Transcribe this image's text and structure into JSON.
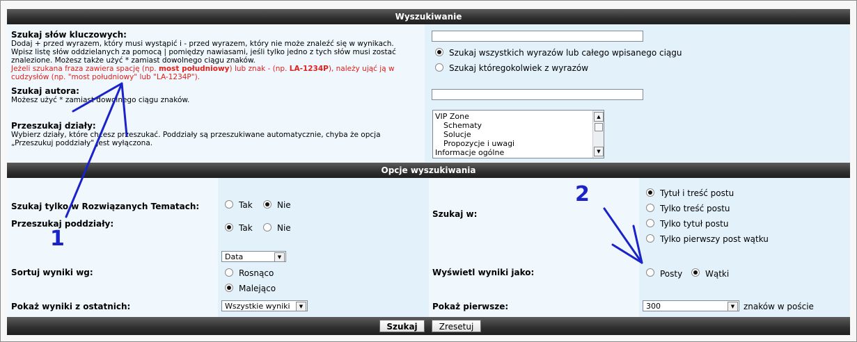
{
  "headers": {
    "search": "Wyszukiwanie",
    "options": "Opcje wyszukiwania"
  },
  "keywords": {
    "label": "Szukaj słów kluczowych:",
    "desc1": "Dodaj + przed wyrazem, który musi wystąpić i - przed wyrazem, który nie może znaleźć się w wynikach.",
    "desc2": "Wpisz listę słów oddzielanych za pomocą | pomiędzy nawiasami, jeśli tylko jedno z tych słów musi zostać",
    "desc3": "znalezione. Możesz także użyć * zamiast dowolnego ciągu znaków.",
    "warn1a": "Jeżeli szukana fraza zawiera spację (np. ",
    "warn1b": "most południowy",
    "warn1c": ") lub znak - (np. ",
    "warn1d": "LA-1234P",
    "warn1e": "), należy ująć ją w",
    "warn2": "cudzysłów (np. \"most południowy\" lub \"LA-1234P\").",
    "value": "",
    "opt_all": "Szukaj wszystkich wyrazów lub całego wpisanego ciągu",
    "opt_any": "Szukaj któregokolwiek z wyrazów"
  },
  "author": {
    "label": "Szukaj autora:",
    "desc": "Możesz użyć * zamiast dowolnego ciągu znaków.",
    "value": ""
  },
  "forums": {
    "label": "Przeszukaj działy:",
    "desc1": "Wybierz działy, które chcesz przeszukać. Poddziały są przeszukiwane automatycznie, chyba że opcja",
    "desc2": "„Przeszukuj poddziały\" jest wyłączona.",
    "items": [
      "VIP Zone",
      "Schematy",
      "Solucje",
      "Propozycje i uwagi",
      "Informacje ogólne"
    ]
  },
  "options": {
    "solved_label": "Szukaj tylko w Rozwiązanych Tematach:",
    "subforums_label": "Przeszukaj poddziały:",
    "sort_label": "Sortuj wyniki wg:",
    "sort_value": "Data",
    "asc": "Rosnąco",
    "desc": "Malejąco",
    "last_label": "Pokaż wyniki z ostatnich:",
    "last_value": "Wszystkie wyniki",
    "yes": "Tak",
    "no": "Nie",
    "search_in_label": "Szukaj w:",
    "in_title_text": "Tytuł i treść postu",
    "in_text": "Tylko treść postu",
    "in_title": "Tylko tytuł postu",
    "in_first": "Tylko pierwszy post wątku",
    "display_label": "Wyświetl wyniki jako:",
    "posts": "Posty",
    "topics": "Wątki",
    "show_first_label": "Pokaż pierwsze:",
    "show_first_value": "300",
    "chars_suffix": "znaków w poście"
  },
  "buttons": {
    "submit": "Szukaj",
    "reset": "Zresetuj"
  },
  "annotations": {
    "one": "1",
    "two": "2"
  }
}
